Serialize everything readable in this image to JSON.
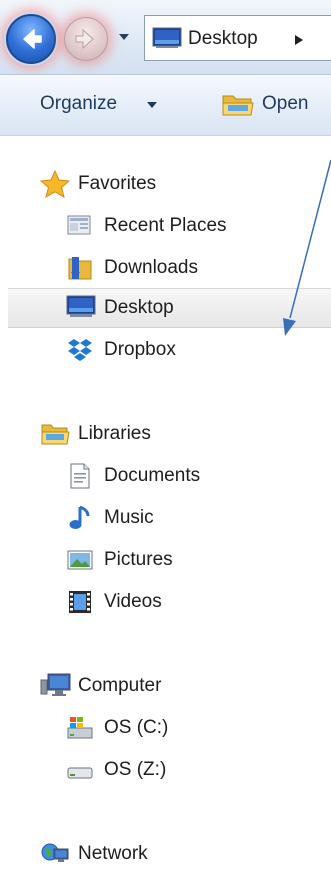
{
  "address_bar": {
    "path": "Desktop",
    "separator": "▸"
  },
  "toolbar": {
    "organize_label": "Organize",
    "open_label": "Open"
  },
  "nav": {
    "favorites": {
      "label": "Favorites",
      "items": [
        {
          "label": "Recent Places",
          "icon": "recent-places-icon"
        },
        {
          "label": "Downloads",
          "icon": "downloads-folder-icon"
        },
        {
          "label": "Desktop",
          "icon": "desktop-icon",
          "selected": true
        },
        {
          "label": "Dropbox",
          "icon": "dropbox-icon"
        }
      ]
    },
    "libraries": {
      "label": "Libraries",
      "items": [
        {
          "label": "Documents",
          "icon": "documents-icon"
        },
        {
          "label": "Music",
          "icon": "music-note-icon"
        },
        {
          "label": "Pictures",
          "icon": "pictures-icon"
        },
        {
          "label": "Videos",
          "icon": "videos-film-icon"
        }
      ]
    },
    "computer": {
      "label": "Computer",
      "items": [
        {
          "label": "OS (C:)",
          "icon": "windows-drive-icon"
        },
        {
          "label": "OS (Z:)",
          "icon": "network-drive-icon"
        }
      ]
    },
    "network": {
      "label": "Network"
    }
  },
  "colors": {
    "accent_blue": "#2e6fd6",
    "selection_bg": "#e8e8e8",
    "annotation_arrow": "#3a6fb7"
  }
}
